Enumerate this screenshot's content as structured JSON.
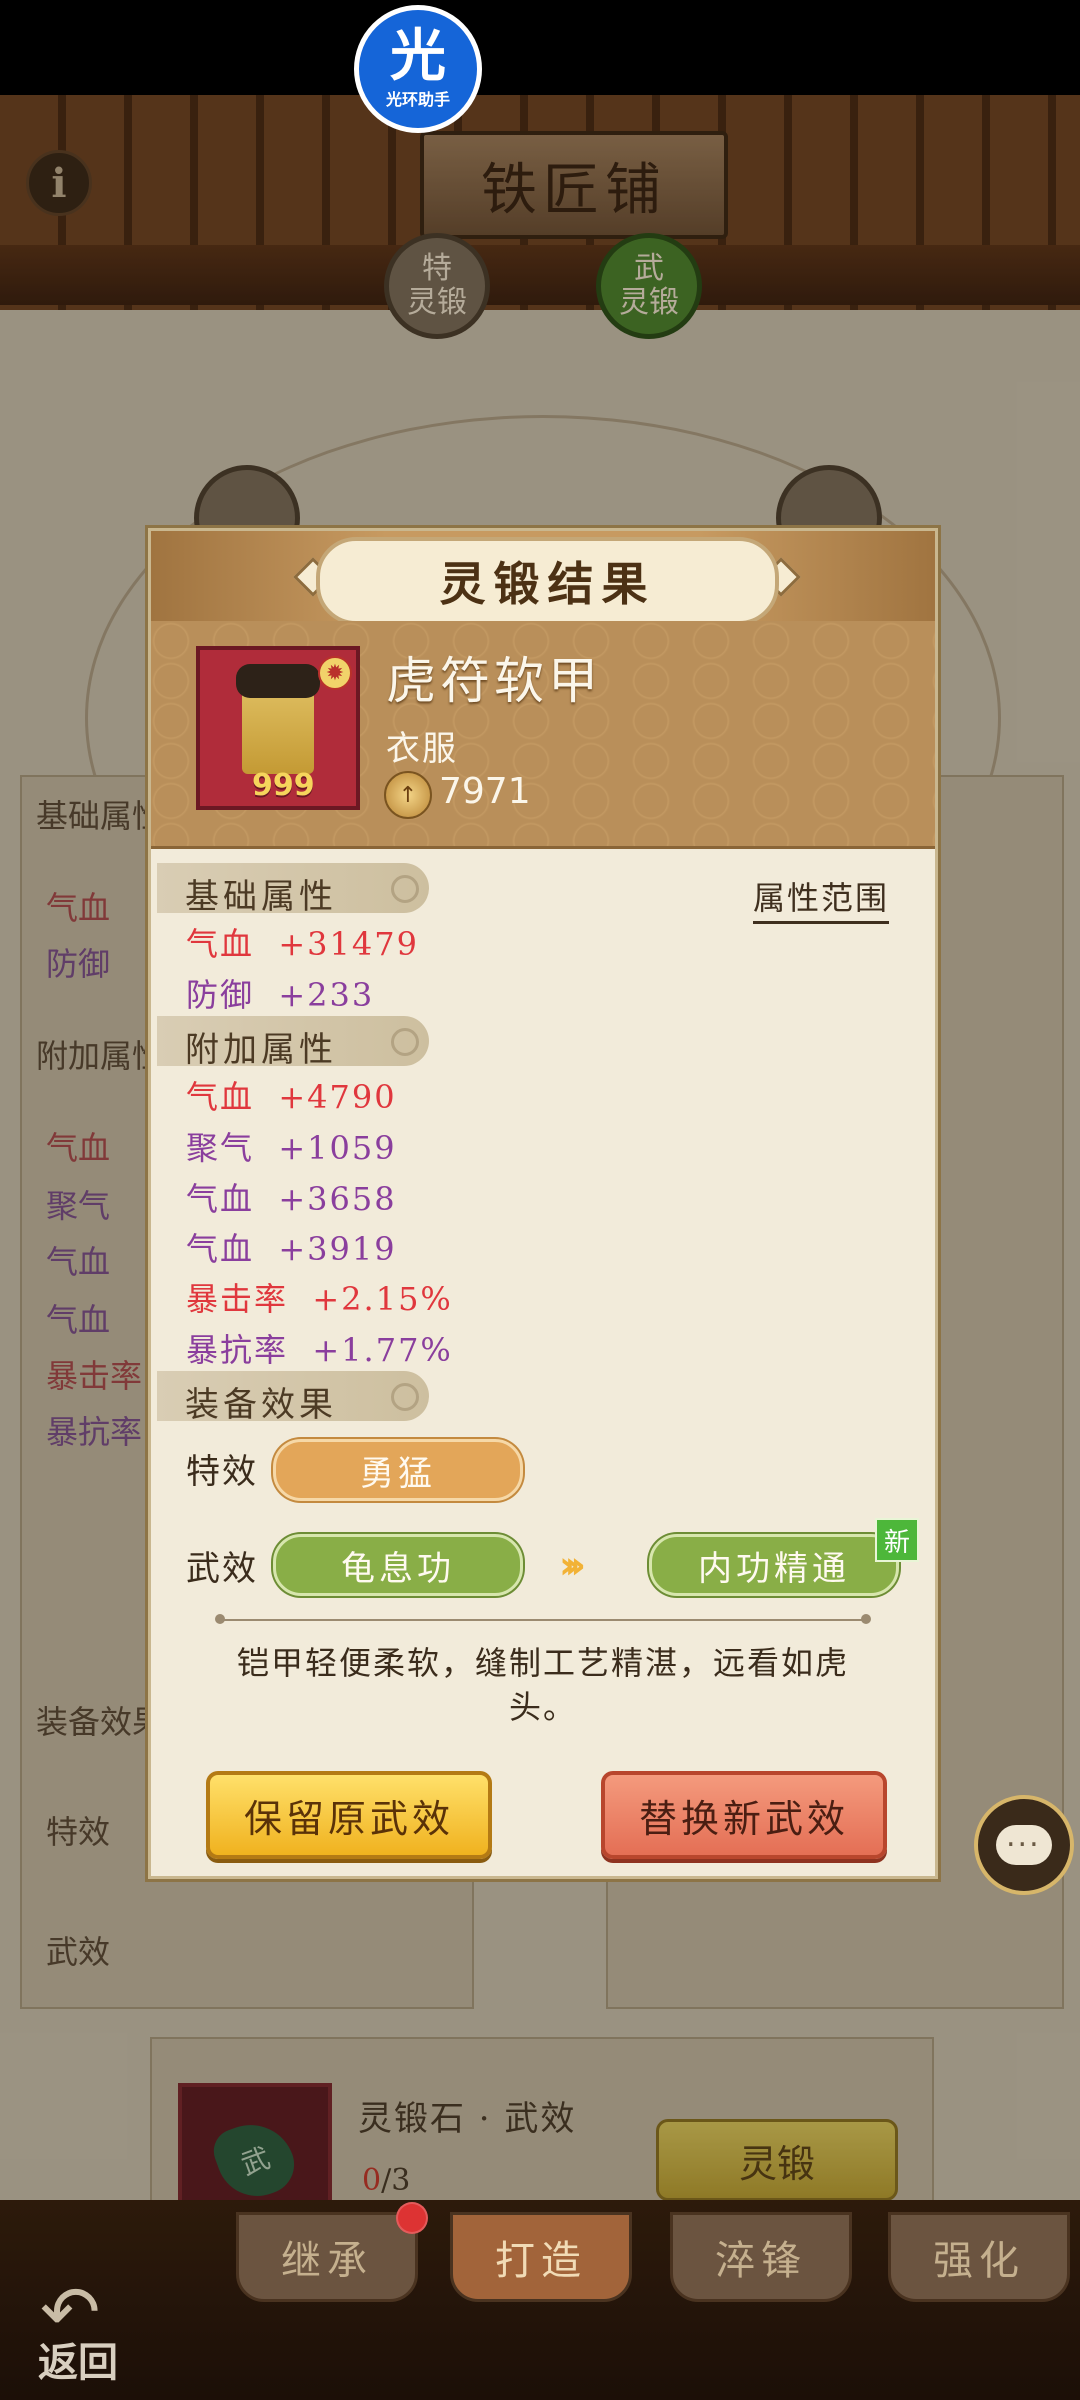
{
  "header": {
    "title": "铁匠铺",
    "helper_big": "光",
    "helper_small": "光环助手",
    "info_icon": "i"
  },
  "forge_tabs": {
    "special": [
      "特",
      "灵锻"
    ],
    "martial": [
      "武",
      "灵锻"
    ]
  },
  "background_panel": {
    "base_header": "基础属性",
    "base_attrs": [
      "气血",
      "防御"
    ],
    "extra_header": "附加属性",
    "extra_attrs": [
      "气血",
      "聚气",
      "气血",
      "气血",
      "暴击率",
      "暴抗率"
    ],
    "effect_header": "装备效果",
    "effect_label": "特效",
    "weapon_label": "武效"
  },
  "modal": {
    "title": "灵锻结果",
    "item": {
      "name": "虎符软甲",
      "type": "衣服",
      "level": "999",
      "power": "7971"
    },
    "attr_range_link": "属性范围",
    "base_section": "基础属性",
    "base_attrs": [
      {
        "name": "气血",
        "value": "+31479",
        "color": "#e0373d"
      },
      {
        "name": "防御",
        "value": "+233",
        "color": "#8a3e9d"
      }
    ],
    "extra_section": "附加属性",
    "extra_attrs": [
      {
        "name": "气血",
        "value": "+4790",
        "color": "#e0373d"
      },
      {
        "name": "聚气",
        "value": "+1059",
        "color": "#8a3e9d"
      },
      {
        "name": "气血",
        "value": "+3658",
        "color": "#8a3e9d"
      },
      {
        "name": "气血",
        "value": "+3919",
        "color": "#8a3e9d"
      },
      {
        "name": "暴击率",
        "value": "+2.15%",
        "color": "#e0373d"
      },
      {
        "name": "暴抗率",
        "value": "+1.77%",
        "color": "#8a3e9d"
      }
    ],
    "effect_section": "装备效果",
    "special_label": "特效",
    "special_value": "勇猛",
    "weapon_label": "武效",
    "old_weapon_effect": "龟息功",
    "new_weapon_effect": "内功精通",
    "new_badge": "新",
    "description": "铠甲轻便柔软，缝制工艺精湛，远看如虎头。",
    "keep_button": "保留原武效",
    "replace_button": "替换新武效"
  },
  "material": {
    "name": "灵锻石 · 武效",
    "icon_char": "武",
    "have": "0",
    "need": "/3",
    "forge_button": "灵锻"
  },
  "bottom_nav": {
    "tabs": [
      "继承",
      "打造",
      "淬锋",
      "强化"
    ],
    "back": "返回"
  }
}
